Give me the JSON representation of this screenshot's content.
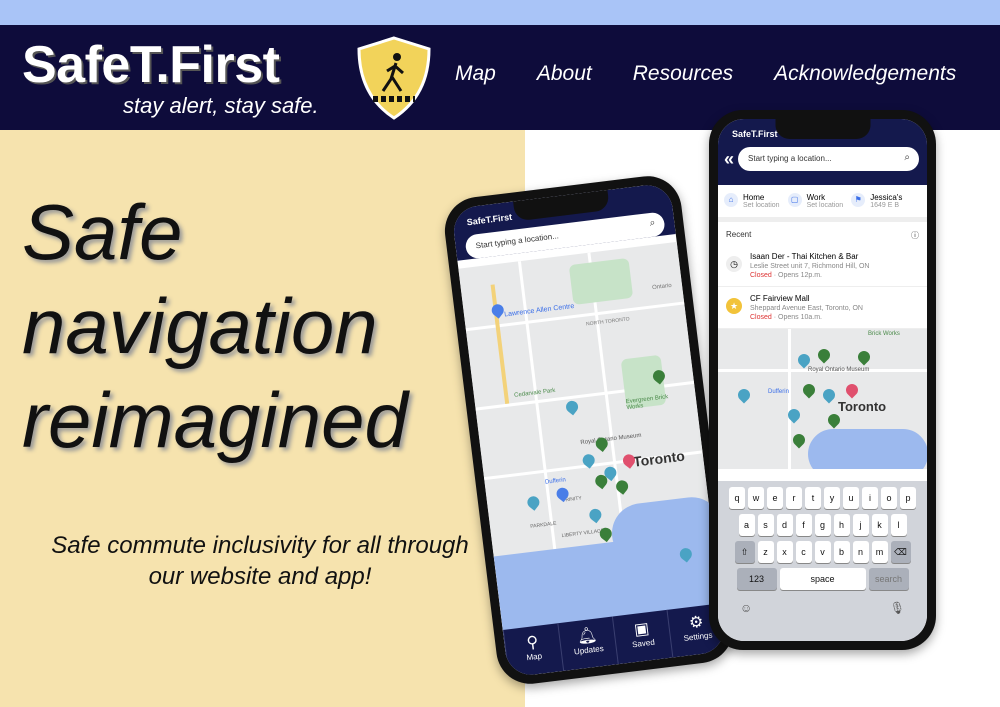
{
  "nav": {
    "brand": "SafeT.First",
    "tagline": "stay alert, stay safe.",
    "links": [
      "Map",
      "About",
      "Resources",
      "Acknowledgements"
    ]
  },
  "hero": {
    "lines": [
      "Safe",
      "navigation",
      "reimagined"
    ],
    "subtitle": "Safe commute inclusivity for all through our website and app!"
  },
  "phone_map": {
    "app_name": "SafeT.First",
    "search_placeholder": "Start typing a location...",
    "map_labels": [
      "Lawrence Allen Centre",
      "NORTH TORONTO",
      "Cedarvale Park",
      "Evergreen Brick Works",
      "Royal Ontario Museum",
      "Toronto",
      "Dufferin",
      "TRINITY",
      "PARKDALE",
      "LIBERTY VILLAGE",
      "Ontario"
    ],
    "tabs": [
      "Map",
      "Updates",
      "Saved",
      "Settings"
    ]
  },
  "phone_search": {
    "app_name": "SafeT.First",
    "search_placeholder": "Start typing a location...",
    "quick": [
      {
        "label": "Home",
        "sub": "Set location"
      },
      {
        "label": "Work",
        "sub": "Set location"
      },
      {
        "label": "Jessica's",
        "sub": "1649 E B"
      }
    ],
    "recent_label": "Recent",
    "recent": [
      {
        "name": "Isaan Der - Thai Kitchen & Bar",
        "address": "Leslie Street unit 7, Richmond Hill, ON",
        "status": "Closed",
        "hours": " · Opens 12p.m."
      },
      {
        "name": "CF Fairview Mall",
        "address": "Sheppard Avenue East, Toronto, ON",
        "status": "Closed",
        "hours": " · Opens 10a.m."
      }
    ],
    "map_labels": [
      "Royal Ontario Museum",
      "Toronto",
      "Dufferin",
      "Brick Works"
    ],
    "keyboard": {
      "row1": [
        "q",
        "w",
        "e",
        "r",
        "t",
        "y",
        "u",
        "i",
        "o",
        "p"
      ],
      "row2": [
        "a",
        "s",
        "d",
        "f",
        "g",
        "h",
        "j",
        "k",
        "l"
      ],
      "row3": [
        "z",
        "x",
        "c",
        "v",
        "b",
        "n",
        "m"
      ],
      "num": "123",
      "space": "space",
      "search": "search"
    }
  },
  "colors": {
    "nav": "#0e0c3b",
    "strip": "#a9c4f7",
    "panel": "#f6e3ae",
    "shield": "#f2d35a"
  }
}
